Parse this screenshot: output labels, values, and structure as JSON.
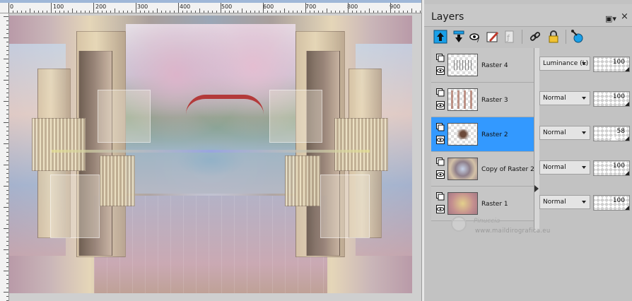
{
  "ruler": {
    "labels": [
      "0",
      "100",
      "200",
      "300",
      "400",
      "500",
      "600",
      "700",
      "800",
      "900"
    ]
  },
  "panel": {
    "title": "Layers",
    "toolbar": [
      {
        "name": "new-raster-layer-icon"
      },
      {
        "name": "new-layer-from-selection-icon"
      },
      {
        "name": "adjust-layer-icon"
      },
      {
        "name": "mask-layer-icon"
      },
      {
        "name": "delete-layer-icon"
      },
      {
        "name": "link-layer-icon"
      },
      {
        "name": "lock-layer-icon"
      },
      {
        "name": "layer-properties-icon"
      }
    ]
  },
  "layers": [
    {
      "name": "Raster 4",
      "blend": "Luminance (L)",
      "opacity": "100",
      "selected": false
    },
    {
      "name": "Raster 3",
      "blend": "Normal",
      "opacity": "100",
      "selected": false
    },
    {
      "name": "Raster 2",
      "blend": "Normal",
      "opacity": "58",
      "selected": true
    },
    {
      "name": "Copy of Raster 2",
      "blend": "Normal",
      "opacity": "100",
      "selected": false
    },
    {
      "name": "Raster 1",
      "blend": "Normal",
      "opacity": "100",
      "selected": false
    }
  ],
  "watermark": {
    "name": "Pinuccia",
    "url": "www.maildirografica.eu"
  },
  "colors": {
    "selection": "#3399ff",
    "panel": "#c2c2c2"
  }
}
